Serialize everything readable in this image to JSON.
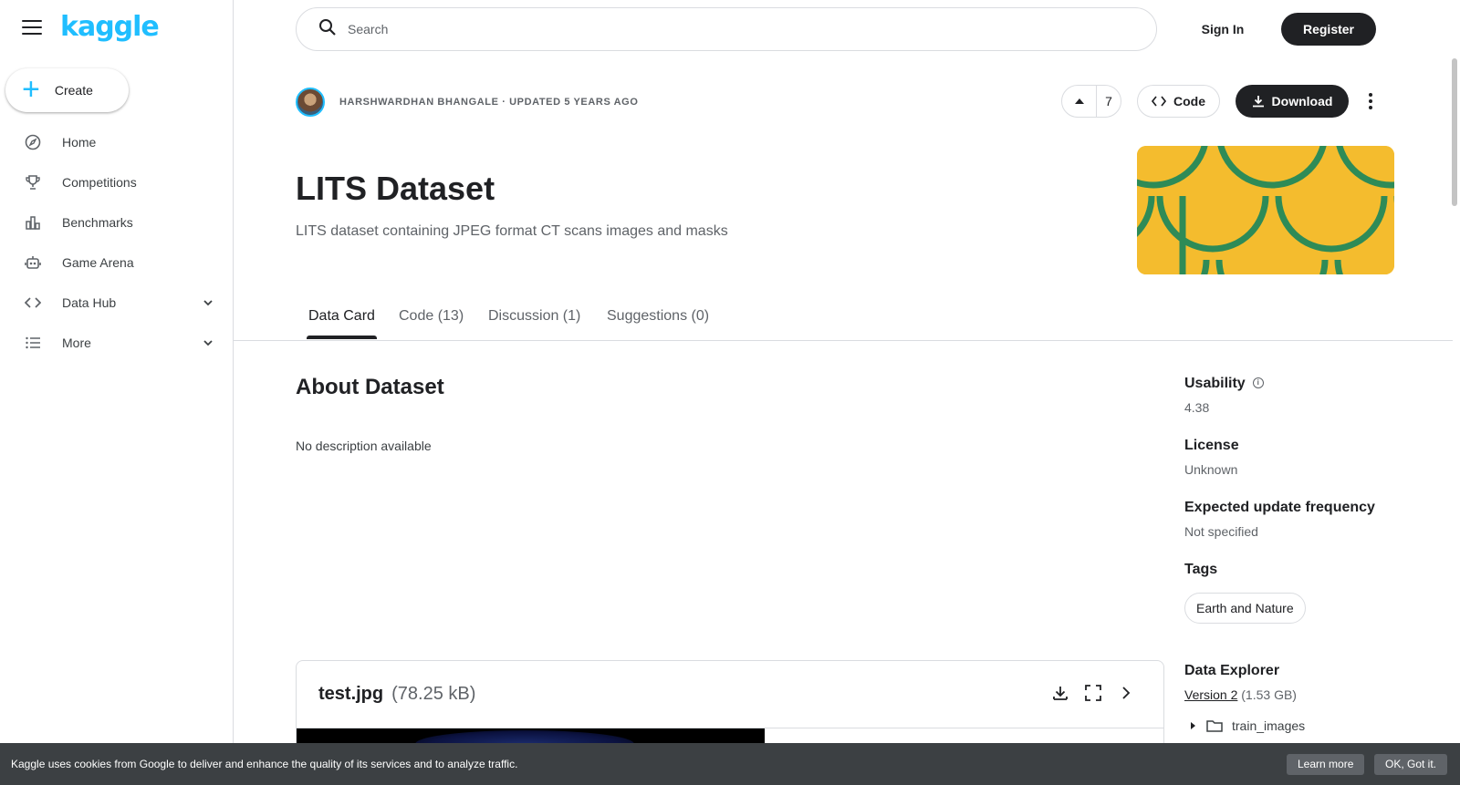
{
  "brand": {
    "logo_text": "kaggle",
    "accent": "#20beff"
  },
  "sidebar": {
    "create_label": "Create",
    "items": [
      {
        "label": "Home",
        "icon": "compass-icon"
      },
      {
        "label": "Competitions",
        "icon": "trophy-icon"
      },
      {
        "label": "Benchmarks",
        "icon": "bar-chart-icon"
      },
      {
        "label": "Game Arena",
        "icon": "robot-icon"
      },
      {
        "label": "Data Hub",
        "icon": "code-icon",
        "expandable": true
      },
      {
        "label": "More",
        "icon": "list-icon",
        "expandable": true
      }
    ]
  },
  "header": {
    "search_placeholder": "Search",
    "signin_label": "Sign In",
    "register_label": "Register"
  },
  "dataset": {
    "byline": "Harshwardhan Bhangale · Updated 5 years ago",
    "vote_count": "7",
    "code_label": "Code",
    "download_label": "Download",
    "title": "LITS Dataset",
    "subtitle": "LITS dataset containing JPEG format CT scans images and masks",
    "cover_colors": {
      "background": "#f4bc2e",
      "scale": "#2e8b57"
    }
  },
  "tabs": [
    {
      "label": "Data Card",
      "active": true
    },
    {
      "label": "Code (13)",
      "active": false
    },
    {
      "label": "Discussion (1)",
      "active": false
    },
    {
      "label": "Suggestions (0)",
      "active": false
    }
  ],
  "about": {
    "title": "About Dataset",
    "description": "No description available"
  },
  "file_preview": {
    "name": "test.jpg",
    "size": "(78.25 kB)"
  },
  "meta": {
    "usability_label": "Usability",
    "usability_value": "4.38",
    "license_label": "License",
    "license_value": "Unknown",
    "frequency_label": "Expected update frequency",
    "frequency_value": "Not specified",
    "tags_label": "Tags",
    "tags": [
      "Earth and Nature"
    ],
    "explorer_label": "Data Explorer",
    "version_link": "Version 2",
    "version_size": "(1.53 GB)",
    "tree_item": "train_images"
  },
  "cookie": {
    "text": "Kaggle uses cookies from Google to deliver and enhance the quality of its services and to analyze traffic.",
    "learn_more": "Learn more",
    "ok": "OK, Got it."
  }
}
